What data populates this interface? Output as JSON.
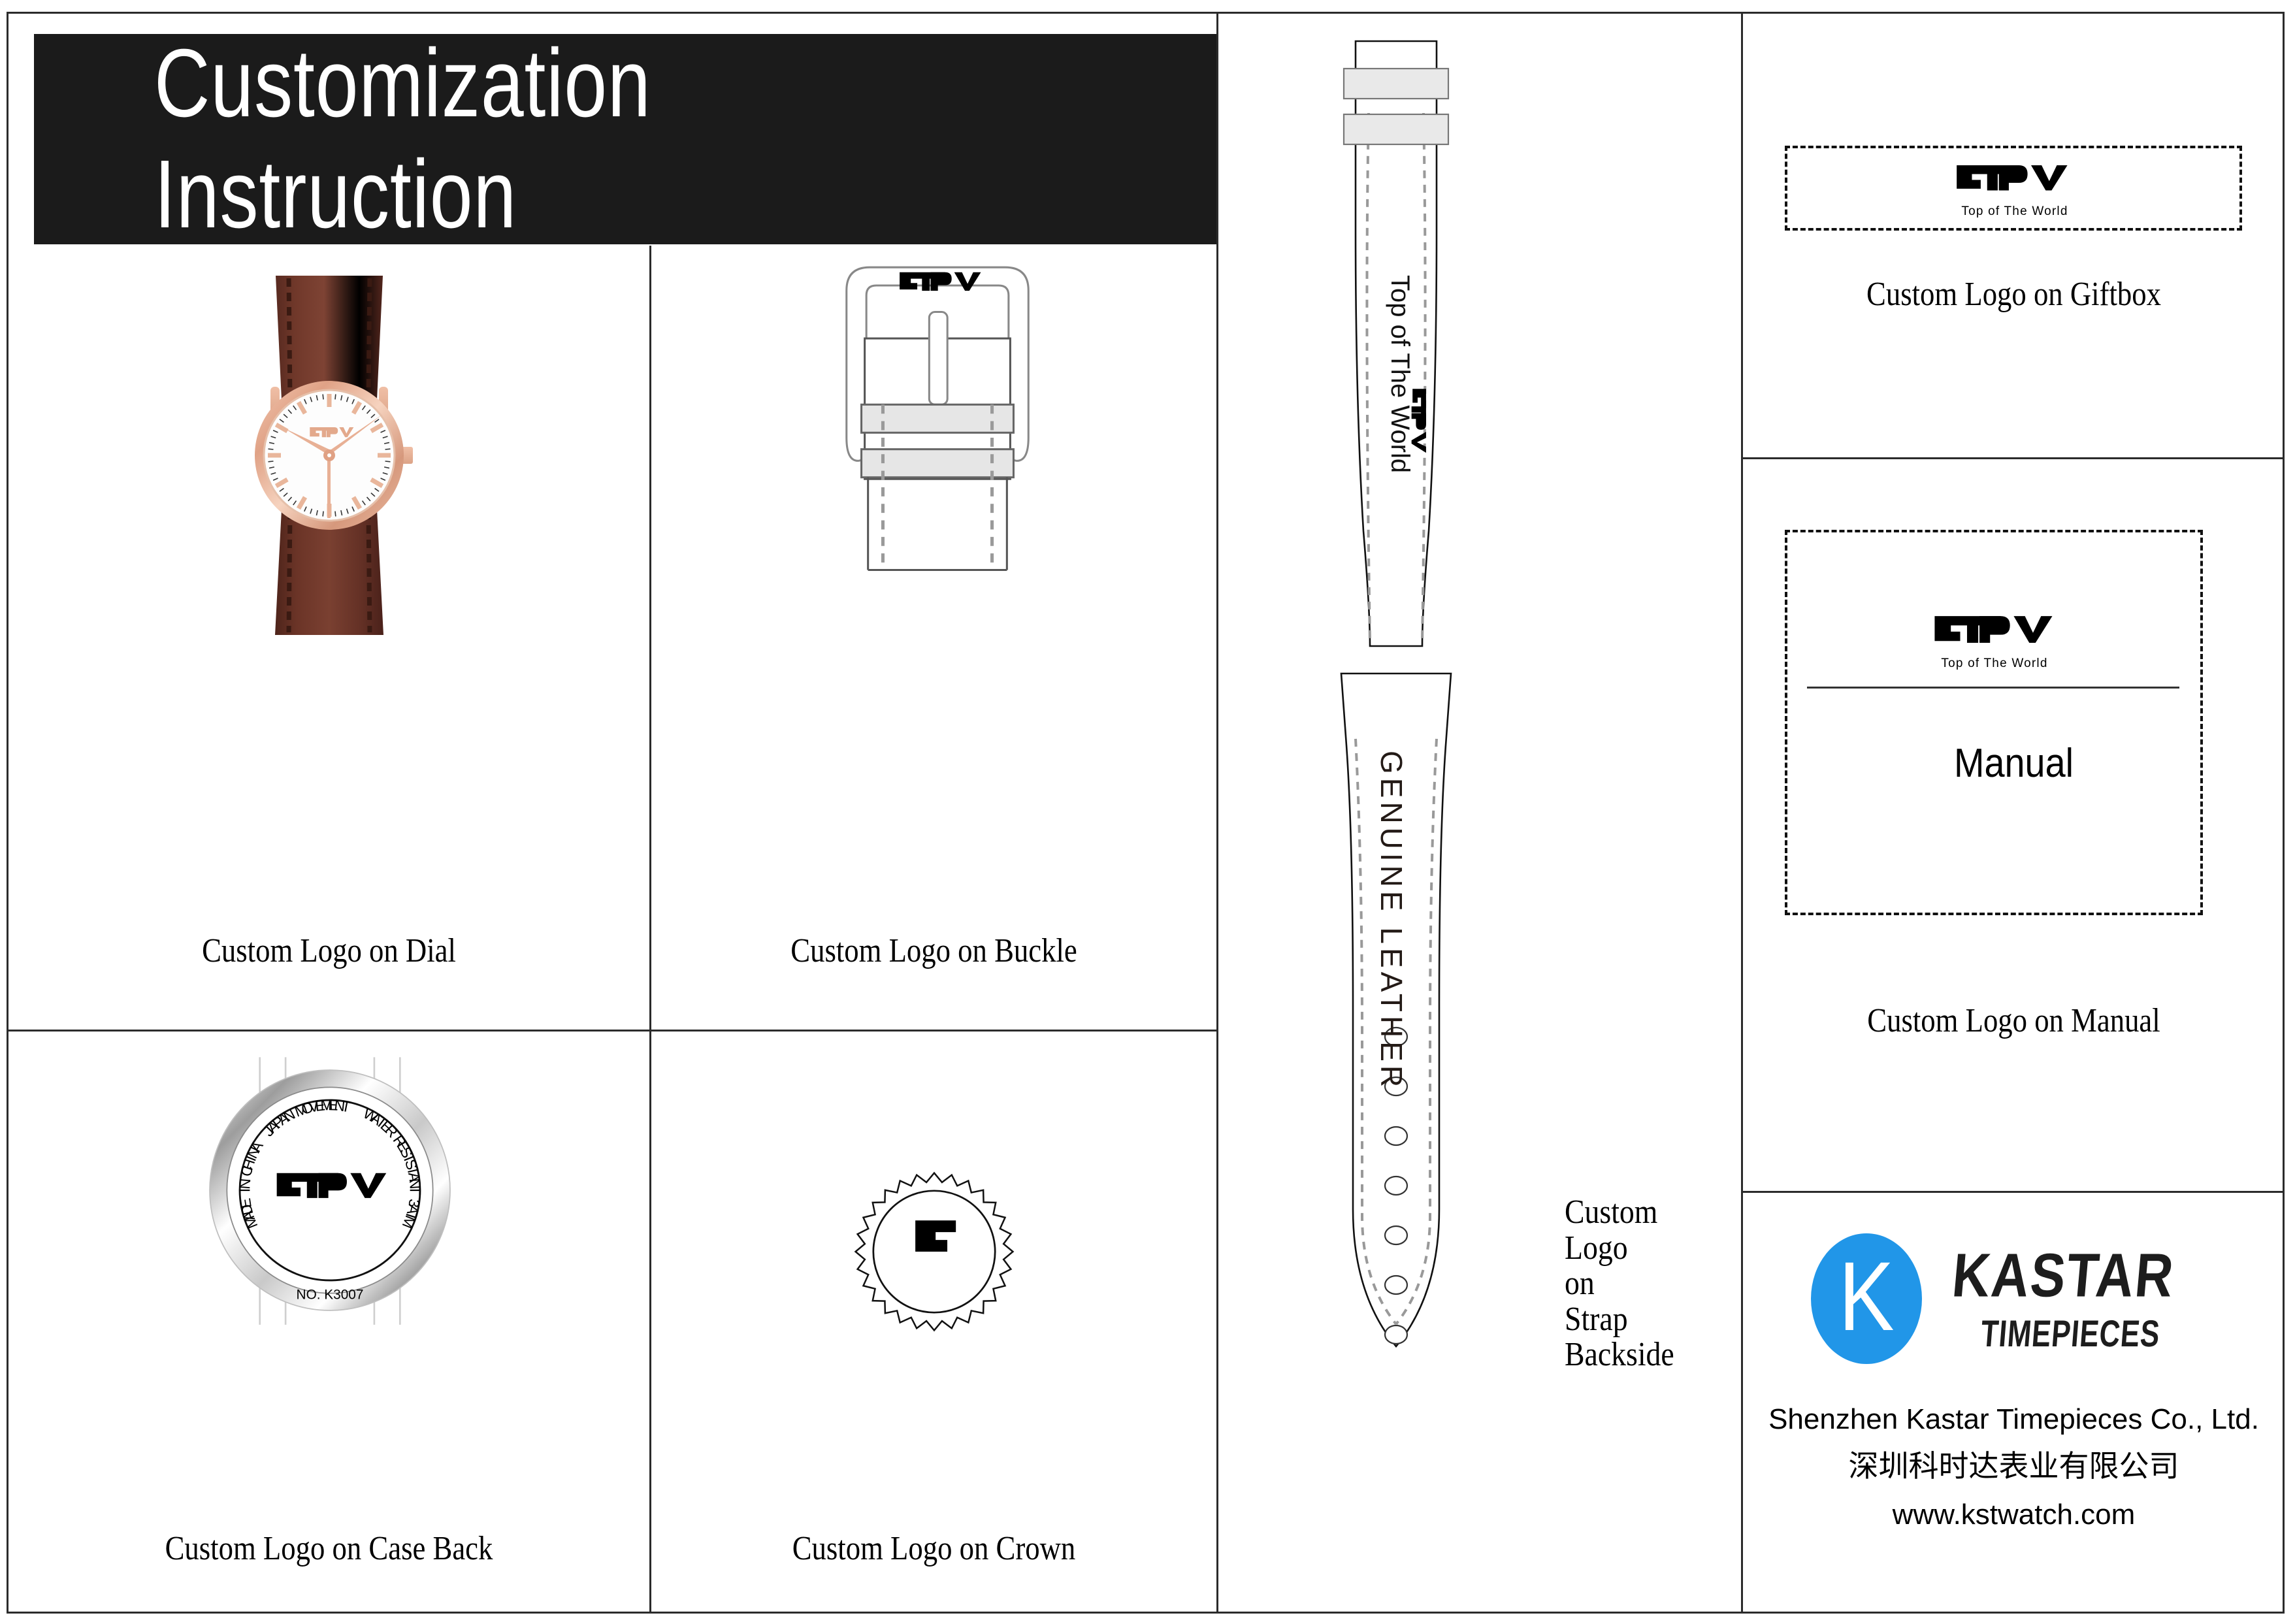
{
  "document": {
    "title": "Customization Instruction",
    "background": "#ffffff",
    "header_bg": "#1b1b1b",
    "border_color": "#2b2b2b"
  },
  "brand": {
    "logo_text": "TPW",
    "tagline": "Top of The World",
    "tagline_strap": "Top of The World"
  },
  "panels": {
    "dial": {
      "label": "Custom Logo on Dial",
      "dial_logo": "TPW",
      "strap_color": "#6e3628"
    },
    "buckle": {
      "label": "Custom Logo on Buckle",
      "buckle_logo": "TPW"
    },
    "case_back": {
      "label": "Custom Logo on Case Back",
      "arc_text": "MADE IN CHINA  JAPAN MOVEMENT   WATER RESISTANT 3ATM",
      "arc_chars": [
        "M",
        "A",
        "D",
        "E",
        " ",
        "I",
        "N",
        " ",
        "C",
        "H",
        "I",
        "N",
        "A",
        " ",
        " ",
        "J",
        "A",
        "P",
        "A",
        "N",
        " ",
        "M",
        "O",
        "V",
        "E",
        "M",
        "E",
        "N",
        "T",
        " ",
        " ",
        " ",
        "W",
        "A",
        "T",
        "E",
        "R",
        " ",
        "R",
        "E",
        "S",
        "I",
        "S",
        "T",
        "A",
        "N",
        "T",
        " ",
        "3",
        "A",
        "T",
        "M"
      ],
      "bottom_text": "NO. K3007",
      "center_logo": "TPW"
    },
    "crown": {
      "label": "Custom Logo on Crown",
      "crown_mark": "t"
    },
    "strap": {
      "label_lines": [
        "Custom",
        "Logo",
        "on",
        "Strap",
        "Backside"
      ],
      "top_strap_text": "Top of The World",
      "top_strap_logo": "TPW",
      "bottom_strap_text": "GENUINE  LEATHER",
      "hole_count": 7
    },
    "giftbox": {
      "label": "Custom Logo on Giftbox",
      "logo": "TPW",
      "tagline": "Top of The World"
    },
    "manual": {
      "label": "Custom Logo on Manual",
      "logo": "TPW",
      "tagline": "Top of The World",
      "word": "Manual"
    },
    "company": {
      "logo_letter": "K",
      "logo_circle_color": "#2196e8",
      "name_main": "KASTAR",
      "name_sub": "TIMEPIECES",
      "line_en": "Shenzhen Kastar Timepieces Co., Ltd.",
      "line_cn": "深圳科时达表业有限公司",
      "website": "www.kstwatch.com"
    }
  }
}
